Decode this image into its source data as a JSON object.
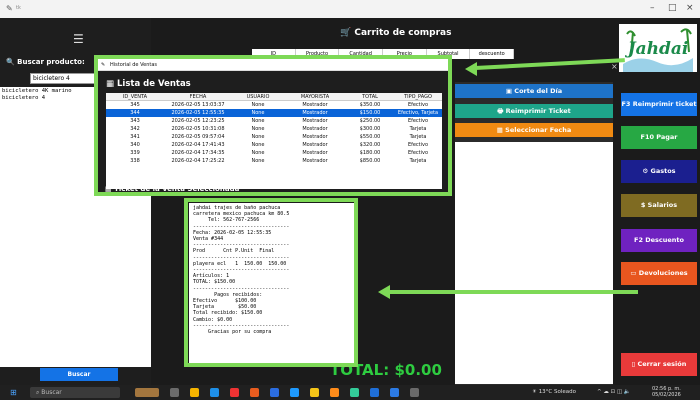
{
  "search_panel": {
    "label": "Buscar producto:",
    "input_value": "bicicletero 4",
    "results": [
      "bicicletero 4K marino",
      "bicicletero 4"
    ],
    "search_button": "Buscar"
  },
  "cart": {
    "title": "Carrito de compras",
    "columns": [
      "ID",
      "Producto",
      "Cantidad",
      "Precio",
      "Subtotal",
      "descuento"
    ],
    "total": "TOTAL: $0.00"
  },
  "actions": {
    "corte": "Corte del Día",
    "reimprimir": "Reimprimir Ticket",
    "seleccionar_fecha": "Seleccionar Fecha"
  },
  "right_buttons": [
    {
      "label": "F3 Reimprimir ticket",
      "color": "#1473e6"
    },
    {
      "label": "F10 Pagar",
      "color": "#27a844"
    },
    {
      "label": "Gastos",
      "color": "#1b1f8f"
    },
    {
      "label": "Salarios",
      "color": "#7f6b22"
    },
    {
      "label": "F2 Descuento",
      "color": "#6f22c0"
    },
    {
      "label": "Devoluciones",
      "color": "#e8561f"
    },
    {
      "label": "Cerrar sesión",
      "color": "#e83a3a"
    }
  ],
  "logo_text": "Jahdai",
  "modal": {
    "window_title": "Historial de Ventas",
    "list_title": "Lista de Ventas",
    "columns": [
      "ID_VENTA",
      "FECHA",
      "USUARIO",
      "MAYORISTA",
      "TOTAL",
      "TIPO_PAGO"
    ],
    "rows": [
      [
        "345",
        "2026-02-05 13:03:37",
        "None",
        "Mostrador",
        "$350.00",
        "Efectivo"
      ],
      [
        "344",
        "2026-02-05 12:55:35",
        "None",
        "Mostrador",
        "$150.00",
        "Efectivo, Tarjeta"
      ],
      [
        "343",
        "2026-02-05 12:23:25",
        "None",
        "Mostrador",
        "$250.00",
        "Efectivo"
      ],
      [
        "342",
        "2026-02-05 10:31:08",
        "None",
        "Mostrador",
        "$300.00",
        "Tarjeta"
      ],
      [
        "341",
        "2026-02-05 09:57:04",
        "None",
        "Mostrador",
        "$550.00",
        "Tarjeta"
      ],
      [
        "340",
        "2026-02-04 17:41:43",
        "None",
        "Mostrador",
        "$320.00",
        "Efectivo"
      ],
      [
        "339",
        "2026-02-04 17:34:35",
        "None",
        "Mostrador",
        "$180.00",
        "Efectivo"
      ],
      [
        "338",
        "2026-02-04 17:25:22",
        "None",
        "Mostrador",
        "$850.00",
        "Tarjeta"
      ]
    ],
    "selected_index": 1,
    "ticket_heading": "Ticket de la Venta Seleccionada"
  },
  "ticket_lines": [
    "jahdai trajes de baño pachuca",
    "carretera mexico pachuca km 80.5",
    "     Tel: 562-767-2566",
    "--------------------------------",
    "Fecha: 2026-02-05 12:55:35",
    "Venta #344",
    "--------------------------------",
    "Prod      Cnt P.Unit  Final",
    "--------------------------------",
    "playera ecl   1  150.00  150.00",
    "--------------------------------",
    "Artículos: 1",
    "TOTAL: $150.00",
    "--------------------------------",
    "       Pagos recibidos:",
    "Efectivo      $100.00",
    "Tarjeta        $50.00",
    "Total recibido: $150.00",
    "Cambio: $0.00",
    "--------------------------------",
    "     Gracias por su compra"
  ],
  "taskbar": {
    "search": "Buscar",
    "weather": "13°C  Soleado",
    "time": "02:56 p. m.",
    "date": "05/02/2026"
  }
}
